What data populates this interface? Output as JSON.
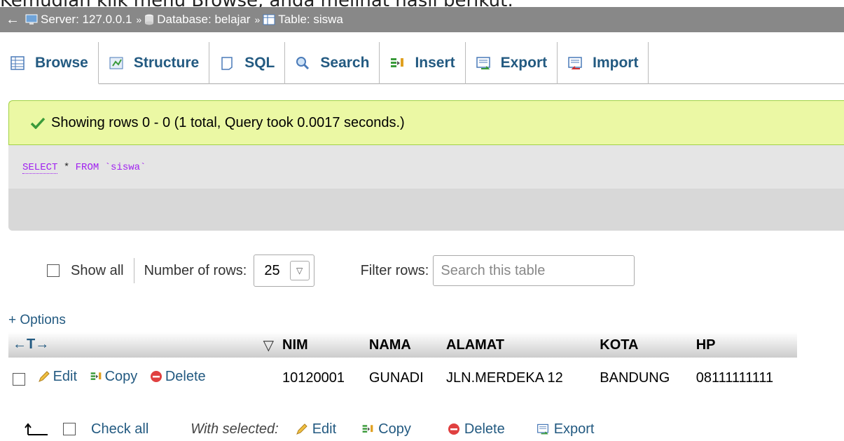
{
  "top_cut_text": "Kemudian klik menu Browse, anda melihat hasil berikut:",
  "breadcrumb": {
    "back": "←",
    "server": "Server: 127.0.0.1",
    "database": "Database: belajar",
    "table": "Table: siswa",
    "sep": "»"
  },
  "tabs": [
    {
      "label": "Browse",
      "icon": "browse-icon"
    },
    {
      "label": "Structure",
      "icon": "structure-icon"
    },
    {
      "label": "SQL",
      "icon": "sql-icon"
    },
    {
      "label": "Search",
      "icon": "search-icon"
    },
    {
      "label": "Insert",
      "icon": "insert-icon"
    },
    {
      "label": "Export",
      "icon": "export-icon"
    },
    {
      "label": "Import",
      "icon": "import-icon"
    }
  ],
  "notice": {
    "text": "Showing rows 0 - 0 (1 total, Query took 0.0017 seconds.)"
  },
  "sql": {
    "select": "SELECT",
    "star": " * ",
    "from": "FROM",
    "table": " `siswa`"
  },
  "nav": {
    "show_all": "Show all",
    "number_of_rows": "Number of rows:",
    "rows_value": "25",
    "filter_rows": "Filter rows:",
    "filter_placeholder": "Search this table"
  },
  "options_label": "+ Options",
  "table": {
    "control_arrows": "←T→",
    "sort_marker": "▽",
    "columns": [
      "NIM",
      "NAMA",
      "ALAMAT",
      "KOTA",
      "HP"
    ],
    "actions": {
      "edit": "Edit",
      "copy": "Copy",
      "delete": "Delete"
    },
    "rows": [
      {
        "NIM": "10120001",
        "NAMA": "GUNADI",
        "ALAMAT": "JLN.MERDEKA 12",
        "KOTA": "BANDUNG",
        "HP": "08111111111"
      }
    ]
  },
  "footer": {
    "check_all": "Check all",
    "with_selected": "With selected:",
    "edit": "Edit",
    "copy": "Copy",
    "delete": "Delete",
    "export": "Export"
  },
  "colors": {
    "link": "#235a81",
    "notice_bg": "#ebf8a4",
    "breadcrumb_bg": "#888888",
    "sql_keyword": "#a020f0"
  }
}
